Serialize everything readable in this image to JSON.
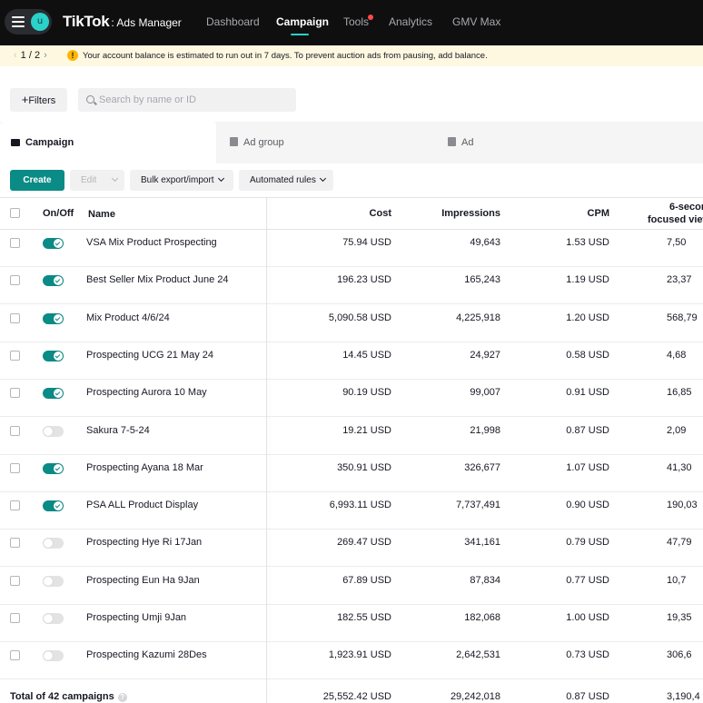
{
  "nav": {
    "avatar_initial": "u",
    "brand": "TikTok",
    "brand_sub": ": Ads Manager",
    "links": [
      "Dashboard",
      "Campaign",
      "Tools",
      "Analytics",
      "GMV Max"
    ],
    "active": "Campaign",
    "accent": "#2ad2c9"
  },
  "banner": {
    "pager": "1 / 2",
    "message": "Your account balance is estimated to run out in 7 days. To prevent auction ads from pausing, add balance."
  },
  "filters": {
    "button_label": "Filters",
    "search_placeholder": "Search by name or ID"
  },
  "tabs": [
    "Campaign",
    "Ad group",
    "Ad"
  ],
  "toolbar": {
    "create": "Create",
    "edit": "Edit",
    "bulk": "Bulk export/import",
    "rules": "Automated rules"
  },
  "table": {
    "headers": {
      "onoff": "On/Off",
      "name": "Name",
      "cost": "Cost",
      "impressions": "Impressions",
      "cpm": "CPM",
      "views_line1": "6-secon",
      "views_line2": "focused view"
    },
    "rows": [
      {
        "on": true,
        "name": "VSA Mix Product Prospecting",
        "cost": "75.94 USD",
        "impressions": "49,643",
        "cpm": "1.53 USD",
        "views": "7,50"
      },
      {
        "on": true,
        "name": "Best Seller Mix Product June 24",
        "cost": "196.23 USD",
        "impressions": "165,243",
        "cpm": "1.19 USD",
        "views": "23,37"
      },
      {
        "on": true,
        "name": "Mix Product 4/6/24",
        "cost": "5,090.58 USD",
        "impressions": "4,225,918",
        "cpm": "1.20 USD",
        "views": "568,79"
      },
      {
        "on": true,
        "name": "Prospecting UCG 21 May 24",
        "cost": "14.45 USD",
        "impressions": "24,927",
        "cpm": "0.58 USD",
        "views": "4,68"
      },
      {
        "on": true,
        "name": "Prospecting Aurora 10 May",
        "cost": "90.19 USD",
        "impressions": "99,007",
        "cpm": "0.91 USD",
        "views": "16,85"
      },
      {
        "on": false,
        "name": "Sakura 7-5-24",
        "cost": "19.21 USD",
        "impressions": "21,998",
        "cpm": "0.87 USD",
        "views": "2,09"
      },
      {
        "on": true,
        "name": "Prospecting Ayana 18 Mar",
        "cost": "350.91 USD",
        "impressions": "326,677",
        "cpm": "1.07 USD",
        "views": "41,30"
      },
      {
        "on": true,
        "name": "PSA ALL Product Display",
        "cost": "6,993.11 USD",
        "impressions": "7,737,491",
        "cpm": "0.90 USD",
        "views": "190,03"
      },
      {
        "on": false,
        "name": "Prospecting Hye Ri 17Jan",
        "cost": "269.47 USD",
        "impressions": "341,161",
        "cpm": "0.79 USD",
        "views": "47,79"
      },
      {
        "on": false,
        "name": "Prospecting Eun Ha 9Jan",
        "cost": "67.89 USD",
        "impressions": "87,834",
        "cpm": "0.77 USD",
        "views": "10,7"
      },
      {
        "on": false,
        "name": "Prospecting Umji 9Jan",
        "cost": "182.55 USD",
        "impressions": "182,068",
        "cpm": "1.00 USD",
        "views": "19,35"
      },
      {
        "on": false,
        "name": "Prospecting Kazumi 28Des",
        "cost": "1,923.91 USD",
        "impressions": "2,642,531",
        "cpm": "0.73 USD",
        "views": "306,6"
      }
    ],
    "total": {
      "label": "Total of 42 campaigns",
      "cost": "25,552.42 USD",
      "impressions": "29,242,018",
      "cpm": "0.87 USD",
      "views": "3,190,4"
    }
  }
}
